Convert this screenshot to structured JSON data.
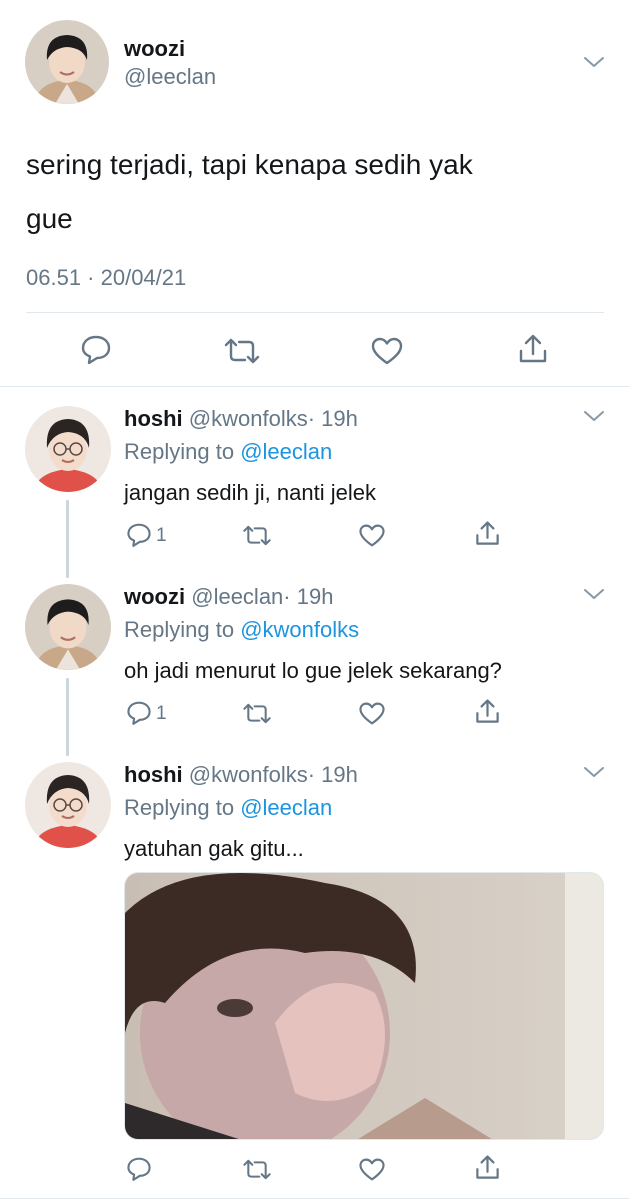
{
  "main_tweet": {
    "name": "woozi",
    "handle": "@leeclan",
    "text_line1": "sering terjadi, tapi kenapa sedih yak",
    "text_line2": "gue",
    "timestamp": "06.51 · 20/04/21"
  },
  "replies": [
    {
      "name": "hoshi",
      "handle": "@kwonfolks",
      "time": "· 19h",
      "replying_prefix": "Replying to",
      "replying_to": "@leeclan",
      "text": "jangan sedih ji, nanti jelek",
      "reply_count": "1"
    },
    {
      "name": "woozi",
      "handle": "@leeclan",
      "time": "· 19h",
      "replying_prefix": "Replying to",
      "replying_to": "@kwonfolks",
      "text": "oh jadi menurut lo gue jelek sekarang?",
      "reply_count": "1"
    },
    {
      "name": "hoshi",
      "handle": "@kwonfolks",
      "time": "· 19h",
      "replying_prefix": "Replying to",
      "replying_to": "@leeclan",
      "text": "yatuhan gak gitu...",
      "reply_count": ""
    }
  ],
  "icons": {
    "reply": "speech-bubble",
    "retweet": "retweet-arrows",
    "like": "heart-outline",
    "share": "share-upload",
    "menu": "chevron-down"
  },
  "colors": {
    "link": "#1b95e0",
    "muted": "#657786",
    "text": "#14171a",
    "divider": "#e1e8ed"
  }
}
